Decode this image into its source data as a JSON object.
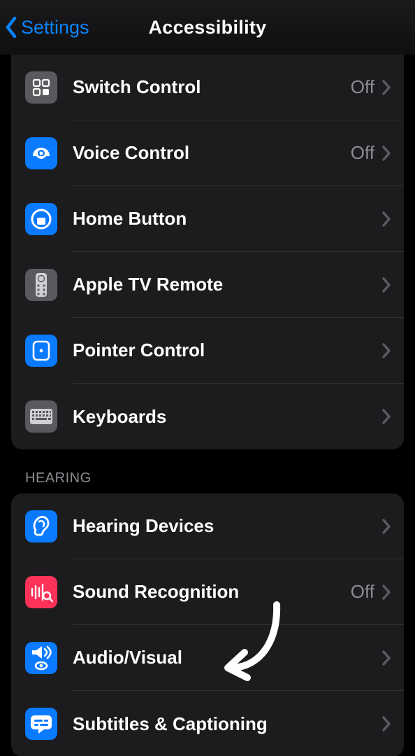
{
  "nav": {
    "back_label": "Settings",
    "title": "Accessibility"
  },
  "groups": {
    "physical": {
      "switch_control": {
        "label": "Switch Control",
        "value": "Off"
      },
      "voice_control": {
        "label": "Voice Control",
        "value": "Off"
      },
      "home_button": {
        "label": "Home Button"
      },
      "apple_tv_remote": {
        "label": "Apple TV Remote"
      },
      "pointer_control": {
        "label": "Pointer Control"
      },
      "keyboards": {
        "label": "Keyboards"
      }
    },
    "hearing": {
      "header": "HEARING",
      "hearing_devices": {
        "label": "Hearing Devices"
      },
      "sound_recognition": {
        "label": "Sound Recognition",
        "value": "Off"
      },
      "audio_visual": {
        "label": "Audio/Visual"
      },
      "subtitles_captioning": {
        "label": "Subtitles & Captioning"
      }
    }
  }
}
